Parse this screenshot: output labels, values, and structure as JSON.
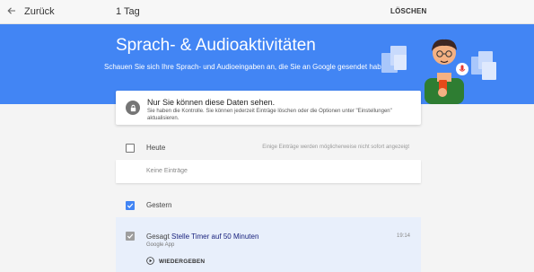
{
  "topbar": {
    "back_label": "Zurück",
    "title": "1 Tag",
    "delete_label": "LÖSCHEN"
  },
  "header": {
    "title": "Sprach- & Audioaktivitäten",
    "description": "Schauen Sie sich Ihre Sprach- und Audioeingaben an, die Sie an Google gesendet haben."
  },
  "privacy_notice": {
    "title": "Nur Sie können diese Daten sehen.",
    "text": "Sie haben die Kontrolle. Sie können jederzeit Einträge löschen oder die Optionen unter \"Einstellungen\" aktualisieren."
  },
  "sections": [
    {
      "label": "Heute",
      "note": "Einige Einträge werden möglicherweise nicht sofort angezeigt",
      "checked": false,
      "empty_text": "Keine Einträge"
    },
    {
      "label": "Gestern",
      "checked": true,
      "items": [
        {
          "prefix": "Gesagt",
          "query": "Stelle Timer auf 50 Minuten",
          "time": "19:14",
          "source": "Google App",
          "play_label": "WIEDERGEBEN",
          "checked": true
        }
      ]
    }
  ],
  "colors": {
    "accent": "#4285f4",
    "header_bg": "#4285f4",
    "selected_item_bg": "#e8effb"
  },
  "icons": [
    "back-arrow-icon",
    "lock-icon",
    "checkbox-icon",
    "play-circle-icon",
    "microphone-icon"
  ]
}
